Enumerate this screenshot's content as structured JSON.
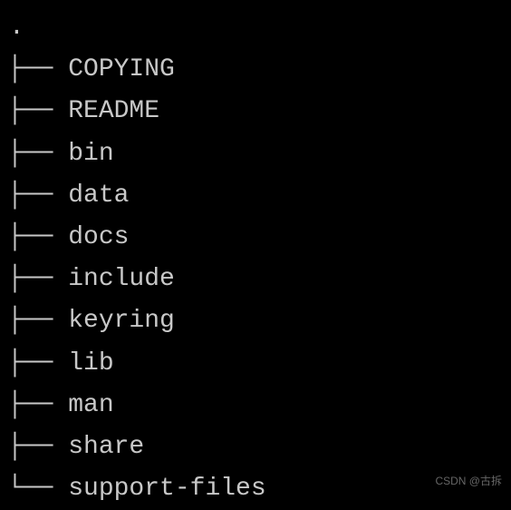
{
  "tree": {
    "root": ".",
    "branch_mid": "├── ",
    "branch_last": "└── ",
    "entries": [
      {
        "name": "COPYING",
        "last": false
      },
      {
        "name": "README",
        "last": false
      },
      {
        "name": "bin",
        "last": false
      },
      {
        "name": "data",
        "last": false
      },
      {
        "name": "docs",
        "last": false
      },
      {
        "name": "include",
        "last": false
      },
      {
        "name": "keyring",
        "last": false
      },
      {
        "name": "lib",
        "last": false
      },
      {
        "name": "man",
        "last": false
      },
      {
        "name": "share",
        "last": false
      },
      {
        "name": "support-files",
        "last": true
      }
    ]
  },
  "watermark": "CSDN @古拆"
}
